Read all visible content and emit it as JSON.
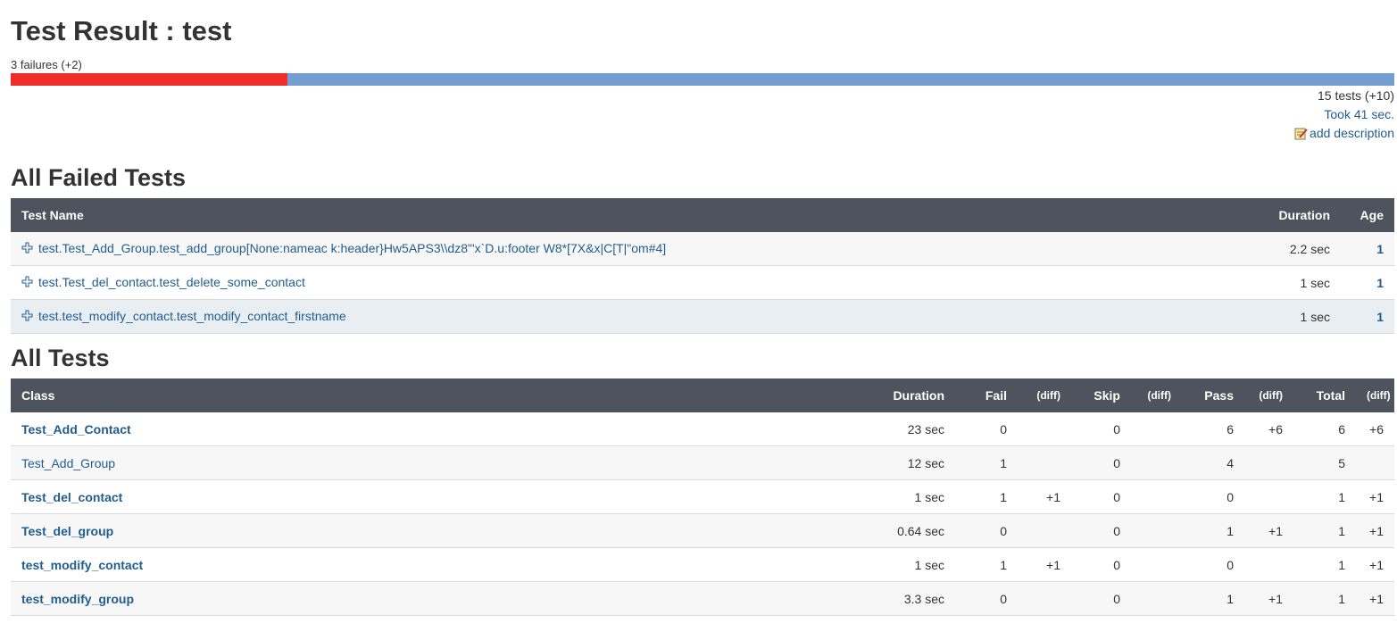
{
  "title": "Test Result : test",
  "summary": "3 failures (+2)",
  "progress": {
    "fail_fraction": 0.2,
    "fail_color": "#f02c2c",
    "pass_color": "#729fcf"
  },
  "tests_count": "15 tests (+10)",
  "took": "Took 41 sec.",
  "add_description": "add description",
  "failed_section": {
    "heading": "All Failed Tests",
    "columns": {
      "name": "Test Name",
      "duration": "Duration",
      "age": "Age"
    },
    "rows": [
      {
        "name": "test.Test_Add_Group.test_add_group[None:nameac k:header}Hw5APS3\\\\dz8\"'x`D.u:footer W8*[7X&x|C[T|\"om#4]",
        "duration": "2.2 sec",
        "age": "1"
      },
      {
        "name": "test.Test_del_contact.test_delete_some_contact",
        "duration": "1 sec",
        "age": "1"
      },
      {
        "name": "test.test_modify_contact.test_modify_contact_firstname",
        "duration": "1 sec",
        "age": "1"
      }
    ]
  },
  "all_section": {
    "heading": "All Tests",
    "columns": {
      "class": "Class",
      "duration": "Duration",
      "fail": "Fail",
      "fail_diff": "(diff)",
      "skip": "Skip",
      "skip_diff": "(diff)",
      "pass": "Pass",
      "pass_diff": "(diff)",
      "total": "Total",
      "total_diff": "(diff)"
    },
    "rows": [
      {
        "class": "Test_Add_Contact",
        "duration": "23 sec",
        "fail": "0",
        "fail_diff": "",
        "skip": "0",
        "skip_diff": "",
        "pass": "6",
        "pass_diff": "+6",
        "total": "6",
        "total_diff": "+6"
      },
      {
        "class": "Test_Add_Group",
        "duration": "12 sec",
        "fail": "1",
        "fail_diff": "",
        "skip": "0",
        "skip_diff": "",
        "pass": "4",
        "pass_diff": "",
        "total": "5",
        "total_diff": ""
      },
      {
        "class": "Test_del_contact",
        "duration": "1 sec",
        "fail": "1",
        "fail_diff": "+1",
        "skip": "0",
        "skip_diff": "",
        "pass": "0",
        "pass_diff": "",
        "total": "1",
        "total_diff": "+1"
      },
      {
        "class": "Test_del_group",
        "duration": "0.64 sec",
        "fail": "0",
        "fail_diff": "",
        "skip": "0",
        "skip_diff": "",
        "pass": "1",
        "pass_diff": "+1",
        "total": "1",
        "total_diff": "+1"
      },
      {
        "class": "test_modify_contact",
        "duration": "1 sec",
        "fail": "1",
        "fail_diff": "+1",
        "skip": "0",
        "skip_diff": "",
        "pass": "0",
        "pass_diff": "",
        "total": "1",
        "total_diff": "+1"
      },
      {
        "class": "test_modify_group",
        "duration": "3.3 sec",
        "fail": "0",
        "fail_diff": "",
        "skip": "0",
        "skip_diff": "",
        "pass": "1",
        "pass_diff": "+1",
        "total": "1",
        "total_diff": "+1"
      }
    ]
  },
  "icons": {
    "expand": "plus-expand-icon",
    "notepad": "notepad-edit-icon"
  }
}
